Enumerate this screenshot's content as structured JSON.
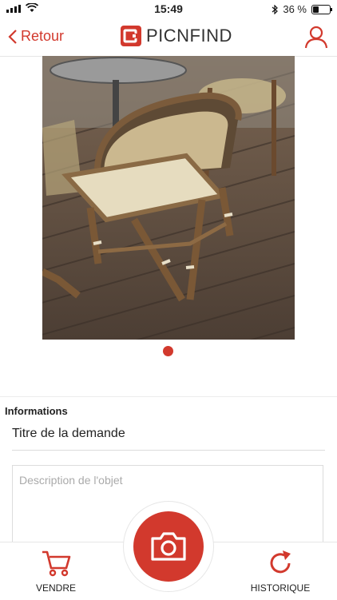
{
  "status_bar": {
    "time": "15:49",
    "battery": "36 %",
    "battery_level": 0.36
  },
  "nav": {
    "back_label": "Retour",
    "title": "PICNFIND"
  },
  "photo": {
    "description": "rattan bistro chair on wooden terrace",
    "pages": 1,
    "current_page": 1
  },
  "form": {
    "section_title": "Informations",
    "title_value": "Titre de la demande",
    "description_placeholder": "Description de l'objet"
  },
  "tabs": {
    "sell_label": "VENDRE",
    "history_label": "HISTORIQUE"
  },
  "colors": {
    "accent": "#d2392d"
  }
}
